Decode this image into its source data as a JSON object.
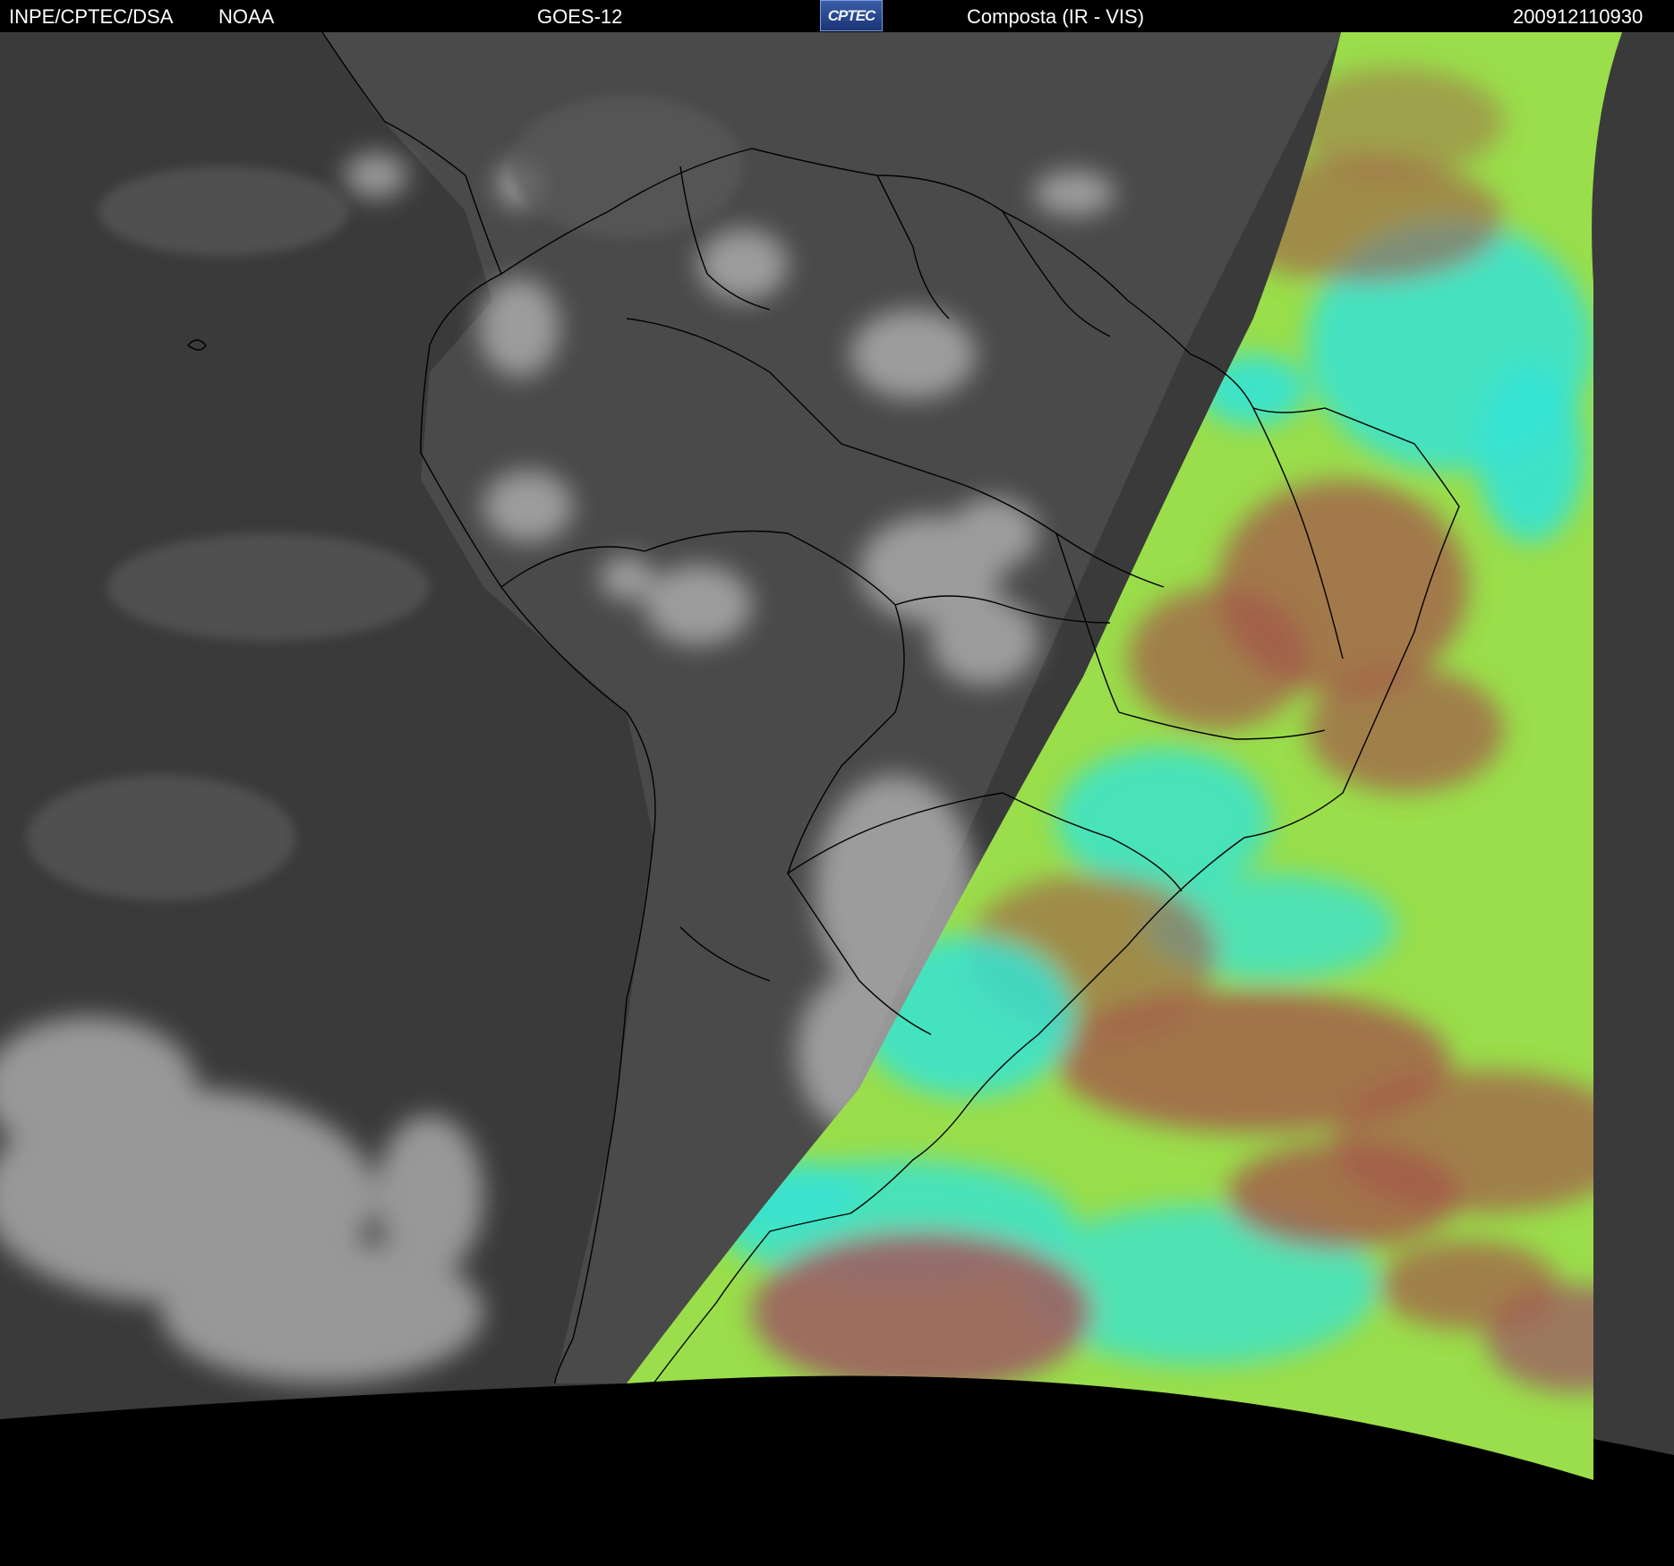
{
  "header": {
    "agency": "INPE/CPTEC/DSA",
    "noaa": "NOAA",
    "satellite": "GOES-12",
    "logo_text": "CPTEC",
    "product": "Composta (IR - VIS)",
    "timestamp": "200912110930"
  },
  "colors": {
    "background": "#000000",
    "ir_ocean": "#3c3c3c",
    "ir_cloud": "#bdbdbd",
    "vis_green": "#9de04a",
    "vis_cyan": "#2fe6d6",
    "vis_red": "#a4574a",
    "borders": "#000000"
  }
}
